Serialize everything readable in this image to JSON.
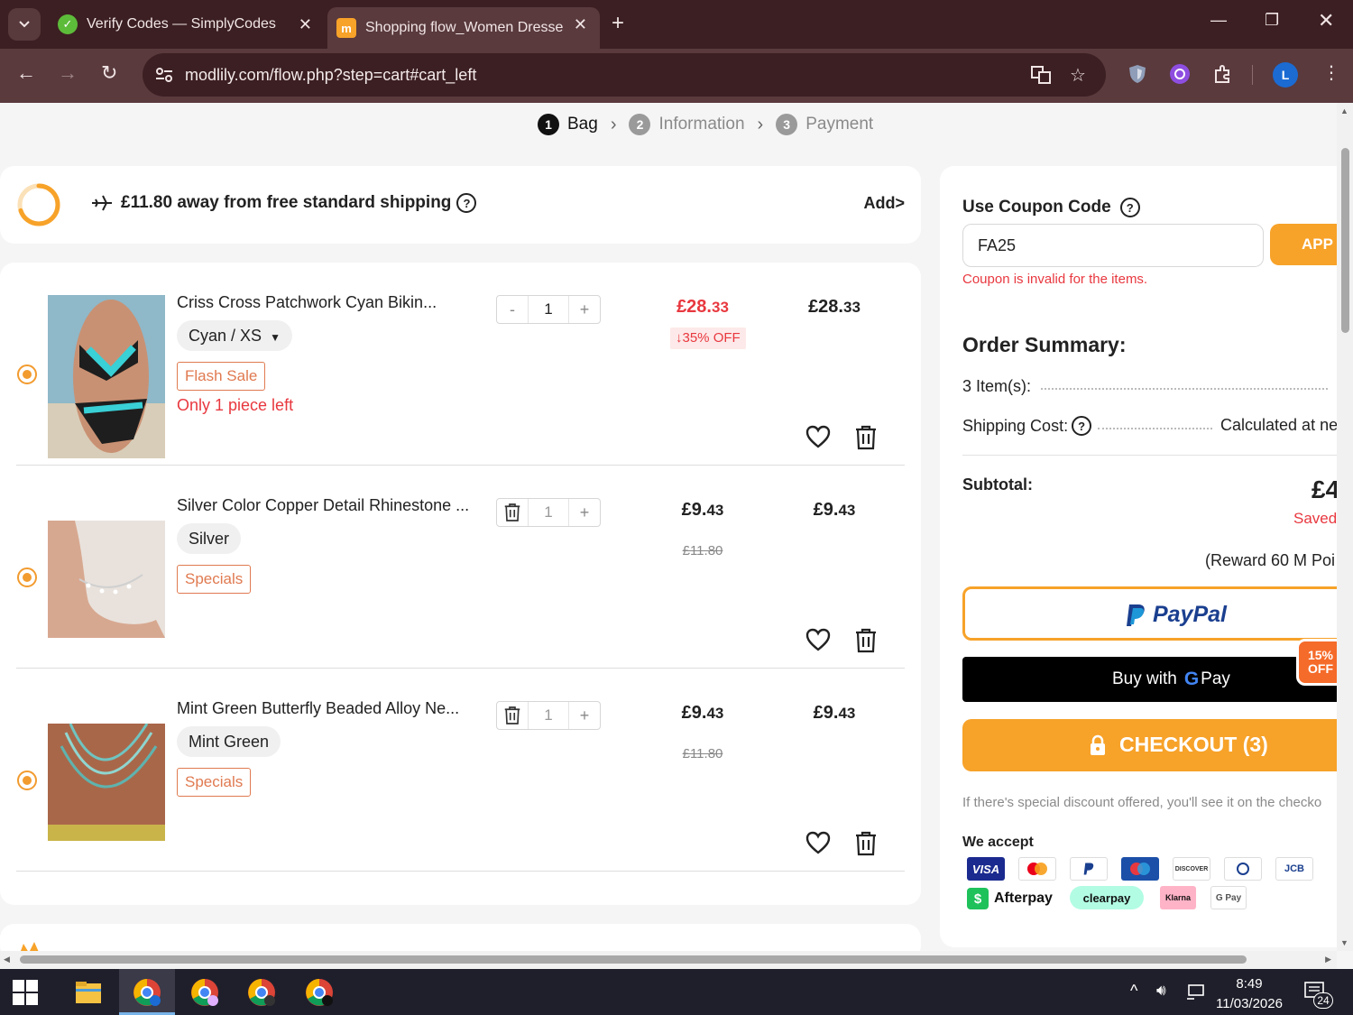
{
  "browser": {
    "tabs": [
      {
        "title": "Verify Codes — SimplyCodes"
      },
      {
        "title": "Shopping flow_Women Dresses"
      }
    ],
    "url": "modlily.com/flow.php?step=cart#cart_left",
    "profile_initial": "L"
  },
  "steps": [
    {
      "num": "1",
      "label": "Bag"
    },
    {
      "num": "2",
      "label": "Information"
    },
    {
      "num": "3",
      "label": "Payment"
    }
  ],
  "shipping": {
    "text": "£11.80 away from free standard shipping",
    "add": "Add>",
    "progress_fraction": 0.7
  },
  "items": [
    {
      "name": "Criss Cross Patchwork Cyan Bikin...",
      "variant": "Cyan / XS",
      "tag": "Flash Sale",
      "stock": "Only 1 piece left",
      "qty": "1",
      "minus": "-",
      "plus": "+",
      "price_main": "£28.",
      "price_cents": "33",
      "discount": "35% OFF",
      "old_price": "",
      "total_main": "£28.",
      "total_cents": "33"
    },
    {
      "name": "Silver Color Copper Detail Rhinestone ...",
      "variant": "Silver",
      "tag": "Specials",
      "stock": "",
      "qty": "1",
      "plus": "+",
      "price_main": "£9.",
      "price_cents": "43",
      "old_price": "£11.80",
      "total_main": "£9.",
      "total_cents": "43"
    },
    {
      "name": "Mint Green Butterfly Beaded Alloy Ne...",
      "variant": "Mint Green",
      "tag": "Specials",
      "stock": "",
      "qty": "1",
      "plus": "+",
      "price_main": "£9.",
      "price_cents": "43",
      "old_price": "£11.80",
      "total_main": "£9.",
      "total_cents": "43"
    }
  ],
  "summary": {
    "coupon_title": "Use Coupon Code",
    "coupon_value": "FA25",
    "apply": "APP",
    "coupon_error": "Coupon is invalid for the items.",
    "order_title": "Order Summary:",
    "items_label": "3 Item(s):",
    "shipping_label": "Shipping Cost:",
    "shipping_value": "Calculated at ne",
    "subtotal_label": "Subtotal:",
    "subtotal_value": "£4",
    "saved": "Saved",
    "reward": "(Reward 60 M Poi",
    "paypal": "PayPal",
    "gpay_prefix": "Buy with",
    "gpay_suffix": "Pay",
    "gpay_badge_1": "15%",
    "gpay_badge_2": "OFF",
    "checkout": "CHECKOUT (3)",
    "discount_note": "If there's special discount offered, you'll see it on the checko",
    "we_accept": "We accept",
    "afterpay": "Afterpay",
    "clearpay": "clearpay",
    "klarna": "Klarna",
    "gpay_small": "G Pay",
    "visa": "VISA",
    "discover": "DISCOVER",
    "jcb": "JCB"
  },
  "taskbar": {
    "time": "8:49",
    "date": "11/03/2026",
    "notifications": "24"
  }
}
